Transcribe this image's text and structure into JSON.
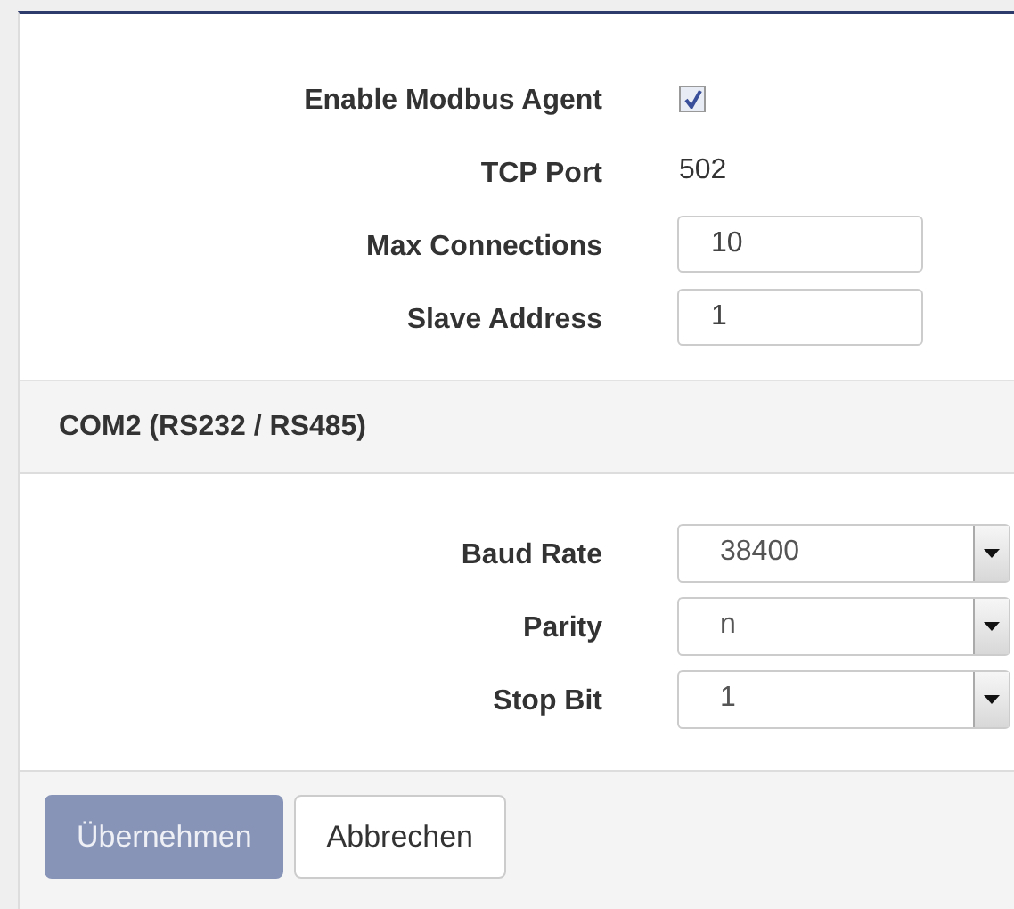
{
  "agent_fields": [
    {
      "kind": "checkbox",
      "label": "Enable Modbus Agent",
      "checked": true
    },
    {
      "kind": "text",
      "label": "TCP Port",
      "value": "502"
    },
    {
      "kind": "input",
      "label": "Max Connections",
      "value": "10"
    },
    {
      "kind": "input",
      "label": "Slave Address",
      "value": "1"
    }
  ],
  "serial_group": {
    "title": "COM2 (RS232 / RS485)",
    "fields": [
      {
        "kind": "select",
        "label": "Baud Rate",
        "value": "38400"
      },
      {
        "kind": "select",
        "label": "Parity",
        "value": "n"
      },
      {
        "kind": "select",
        "label": "Stop Bit",
        "value": "1"
      }
    ]
  },
  "buttons": [
    {
      "kind": "primary",
      "label": "Übernehmen",
      "disabled": true
    },
    {
      "kind": "default",
      "label": "Abbrechen",
      "disabled": false
    }
  ]
}
